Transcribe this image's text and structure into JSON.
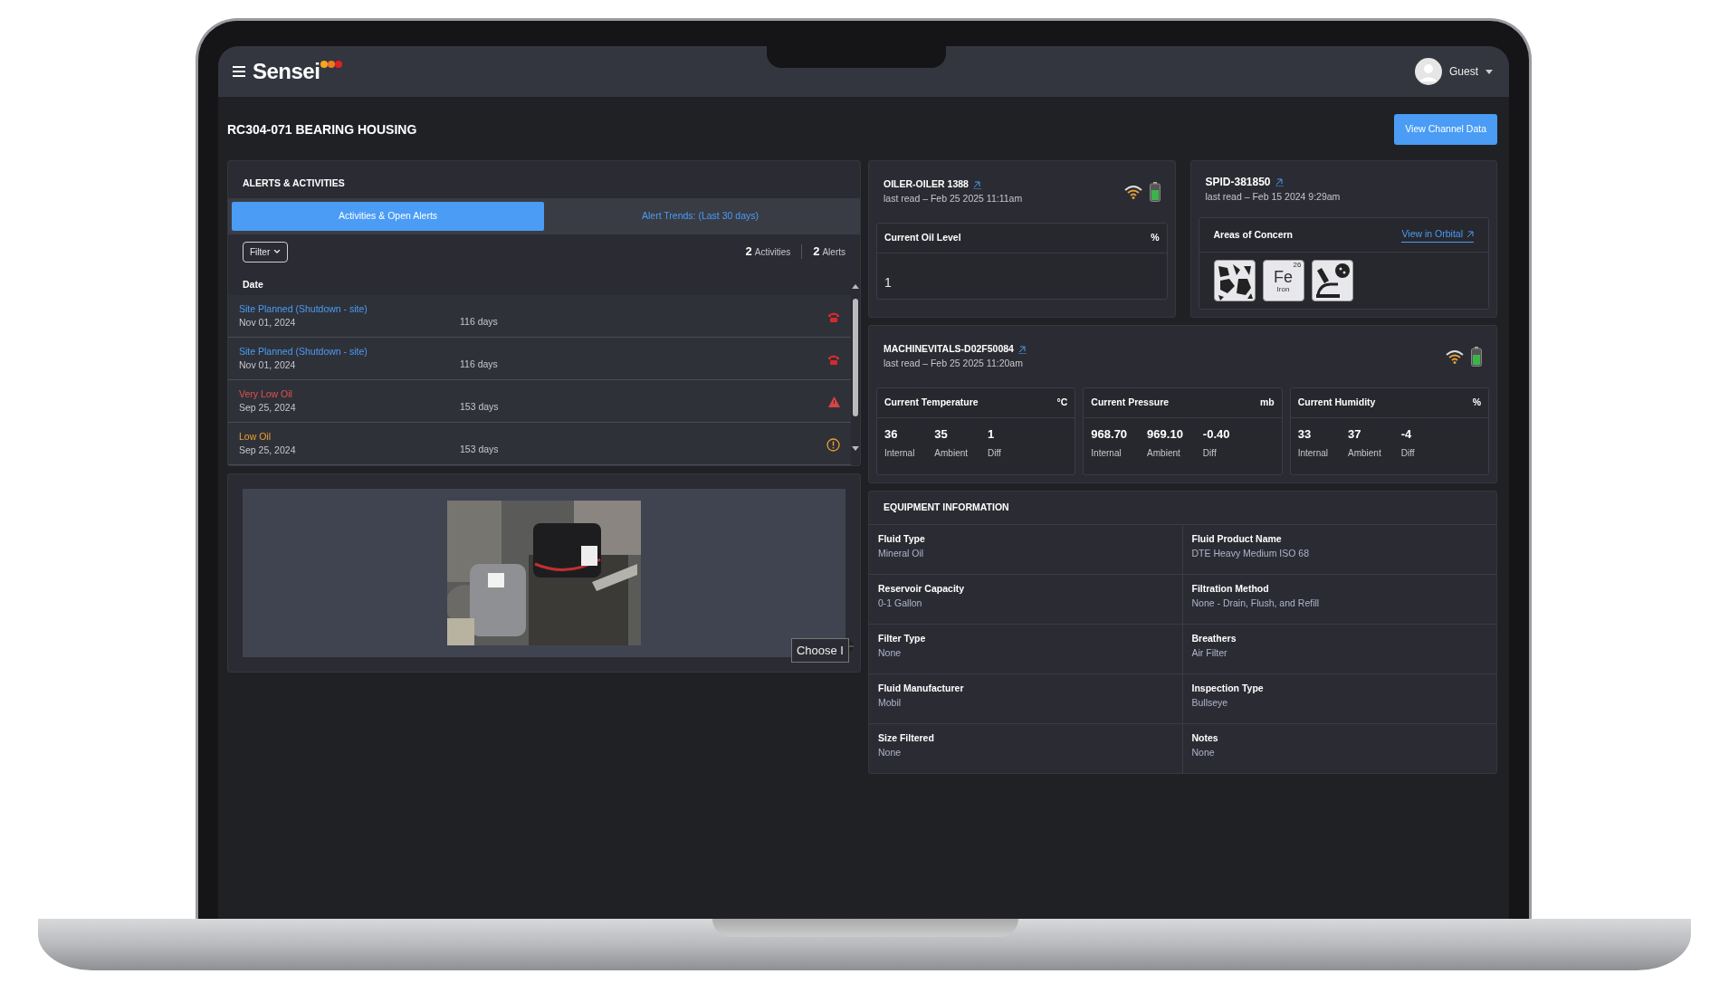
{
  "header": {
    "brand": "Sensei",
    "user": "Guest"
  },
  "page": {
    "title": "RC304-071 BEARING HOUSING",
    "action": "View Channel Data"
  },
  "alerts": {
    "title": "ALERTS & ACTIVITIES",
    "tabs": [
      {
        "label": "Activities & Open Alerts",
        "selected": true
      },
      {
        "label": "Alert Trends: (Last 30 days)",
        "selected": false
      }
    ],
    "filter": "Filter",
    "counts": [
      {
        "value": "2",
        "label": "Activities"
      },
      {
        "value": "2",
        "label": "Alerts"
      }
    ],
    "column": "Date",
    "rows": [
      {
        "title": "Site Planned (Shutdown - site)",
        "date": "Nov 01, 2024",
        "age": "116 days",
        "kind": "planned"
      },
      {
        "title": "Site Planned (Shutdown - site)",
        "date": "Nov 01, 2024",
        "age": "116 days",
        "kind": "planned"
      },
      {
        "title": "Very Low Oil",
        "date": "Sep 25, 2024",
        "age": "153 days",
        "kind": "critical"
      },
      {
        "title": "Low Oil",
        "date": "Sep 25, 2024",
        "age": "153 days",
        "kind": "warning"
      }
    ]
  },
  "photo": {
    "kind": "picture",
    "tooltip": "Choose I"
  },
  "oiler": {
    "name": "OILER-OILER 1388",
    "last_read": "last read – Feb 25 2025 11:11am",
    "metric": {
      "label": "Current Oil Level",
      "unit": "%",
      "value": "1"
    }
  },
  "spid": {
    "name": "SPID-381850",
    "last_read": "last read – Feb 15 2024 9:29am",
    "areas_title": "Areas of Concern",
    "link": "View in Orbital",
    "concerns": [
      {
        "kind": "particles"
      },
      {
        "kind": "element",
        "symbol": "Fe",
        "number": "26",
        "name": "Iron"
      },
      {
        "kind": "microscope"
      }
    ]
  },
  "vitals": {
    "name": "MACHINEVITALS-D02F50084",
    "last_read": "last read – Feb 25 2025 11:20am",
    "metrics": [
      {
        "label": "Current Temperature",
        "unit": "°C",
        "readings": [
          {
            "value": "36",
            "label": "Internal"
          },
          {
            "value": "35",
            "label": "Ambient"
          },
          {
            "value": "1",
            "label": "Diff"
          }
        ]
      },
      {
        "label": "Current Pressure",
        "unit": "mb",
        "readings": [
          {
            "value": "968.70",
            "label": "Internal"
          },
          {
            "value": "969.10",
            "label": "Ambient"
          },
          {
            "value": "-0.40",
            "label": "Diff"
          }
        ]
      },
      {
        "label": "Current Humidity",
        "unit": "%",
        "readings": [
          {
            "value": "33",
            "label": "Internal"
          },
          {
            "value": "37",
            "label": "Ambient"
          },
          {
            "value": "-4",
            "label": "Diff"
          }
        ]
      }
    ]
  },
  "equipment": {
    "title": "EQUIPMENT INFORMATION",
    "fields": [
      {
        "label": "Fluid Type",
        "value": "Mineral Oil"
      },
      {
        "label": "Fluid Product Name",
        "value": "DTE Heavy Medium ISO 68"
      },
      {
        "label": "Reservoir Capacity",
        "value": "0-1 Gallon"
      },
      {
        "label": "Filtration Method",
        "value": "None - Drain, Flush, and Refill"
      },
      {
        "label": "Filter Type",
        "value": "None"
      },
      {
        "label": "Breathers",
        "value": "Air Filter"
      },
      {
        "label": "Fluid Manufacturer",
        "value": "Mobil"
      },
      {
        "label": "Inspection Type",
        "value": "Bullseye"
      },
      {
        "label": "Size Filtered",
        "value": "None"
      },
      {
        "label": "Notes",
        "value": "None"
      }
    ]
  }
}
